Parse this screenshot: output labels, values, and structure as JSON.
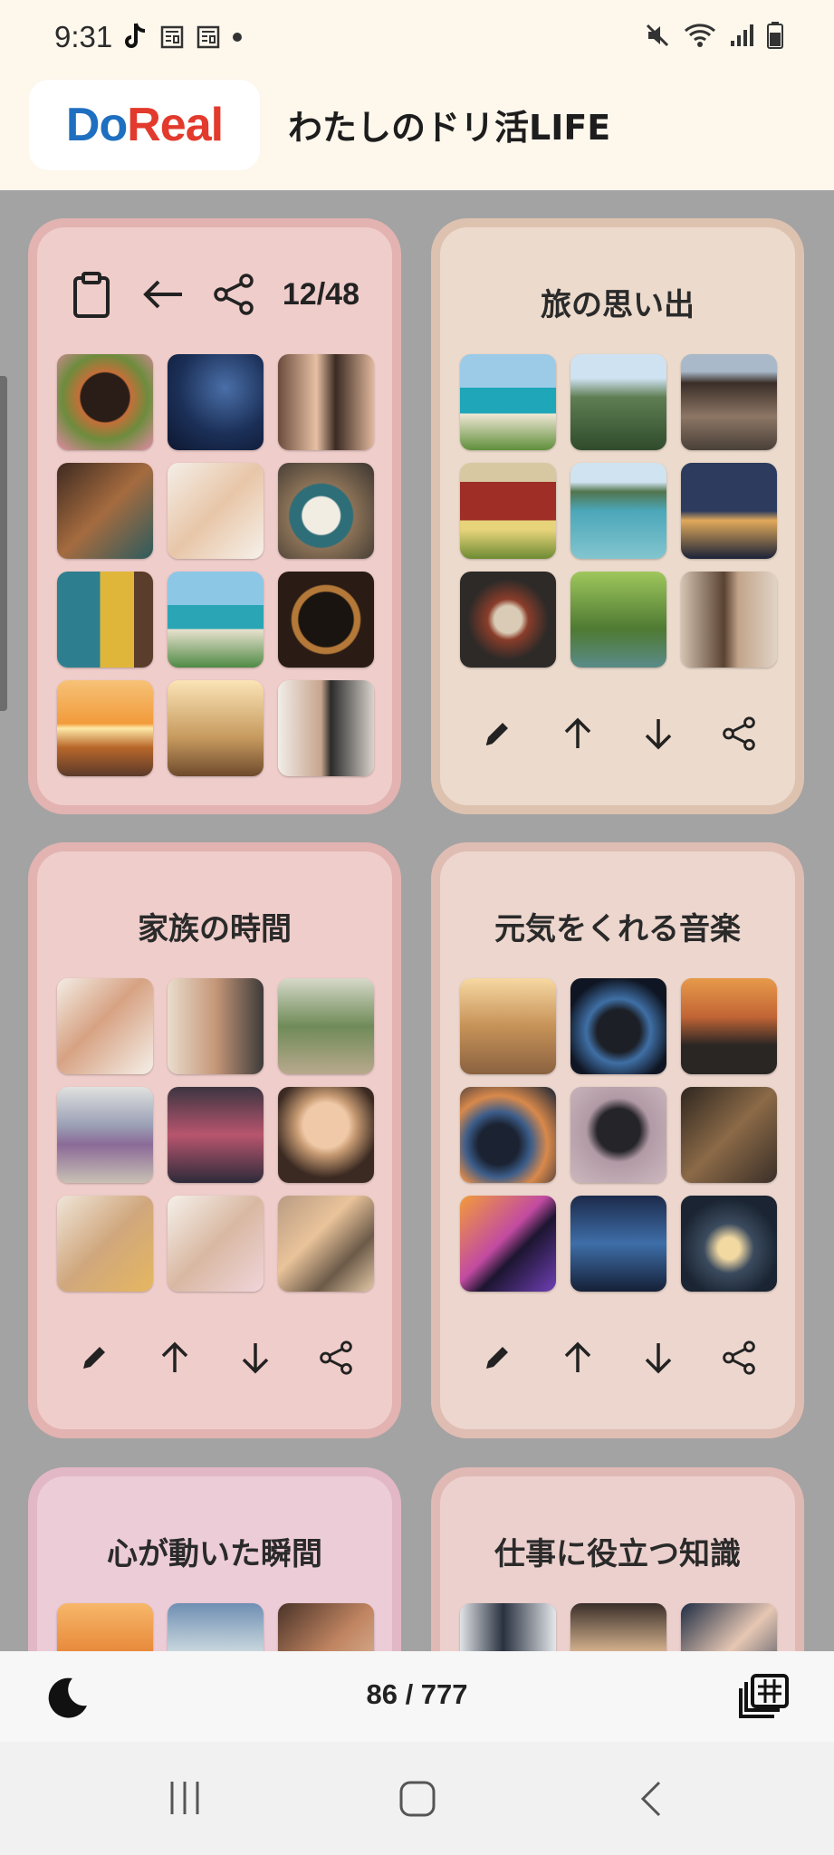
{
  "status_bar": {
    "time": "9:31"
  },
  "header": {
    "logo_prefix": "Do",
    "logo_suffix": "Real",
    "title": "わたしのドリ活LIFE"
  },
  "card1": {
    "counter": "12/48"
  },
  "cards": [
    {
      "title": "旅の思い出"
    },
    {
      "title": "家族の時間"
    },
    {
      "title": "元気をくれる音楽"
    },
    {
      "title": "心が動いた瞬間"
    },
    {
      "title": "仕事に役立つ知識"
    }
  ],
  "bottom_bar": {
    "page_count": "86 / 777"
  },
  "colors": {
    "header_bg": "#fdf7ec",
    "card_pink": "#efc9c6",
    "card_beige": "#ecd9cb",
    "logo_blue": "#1f6fc0",
    "logo_red": "#e23a2c"
  }
}
